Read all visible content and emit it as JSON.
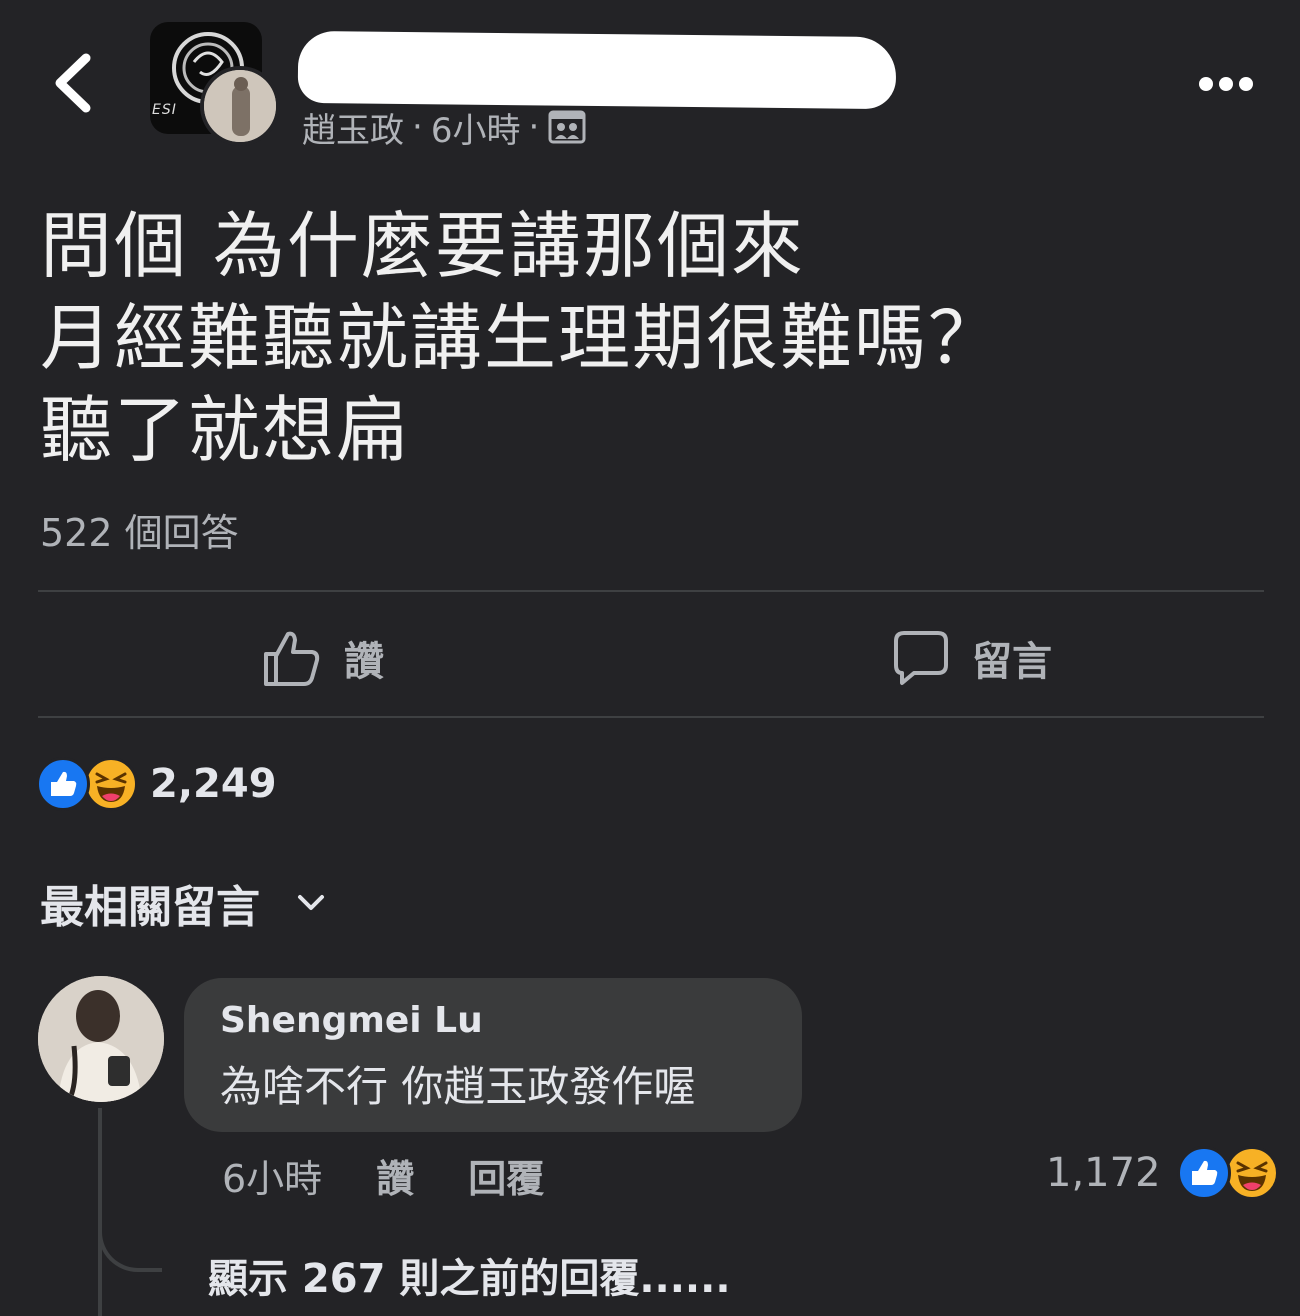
{
  "header": {
    "author": "趙玉政",
    "time": "6小時",
    "separator": "·",
    "audience_icon": "group-members-icon"
  },
  "post": {
    "lines": [
      "問個 為什麼要講那個來",
      "月經難聽就講生理期很難嗎？",
      "聽了就想扁"
    ],
    "answers": "522 個回答"
  },
  "actions": {
    "like_label": "讚",
    "comment_label": "留言"
  },
  "reactions": {
    "count": "2,249",
    "types": [
      "like",
      "haha"
    ]
  },
  "comments_section": {
    "sort_label": "最相關留言"
  },
  "comment": {
    "author": "Shengmei Lu",
    "text": "為啥不行 你趙玉政發作喔",
    "time": "6小時",
    "like_label": "讚",
    "reply_label": "回覆",
    "reaction_count": "1,172",
    "view_previous": "顯示 267 則之前的回覆......"
  },
  "colors": {
    "background": "#232326",
    "bubble": "#3a3b3c",
    "like_blue": "#1877f2",
    "haha_yellow": "#f7b125",
    "secondary_text": "#b0b3b8"
  }
}
